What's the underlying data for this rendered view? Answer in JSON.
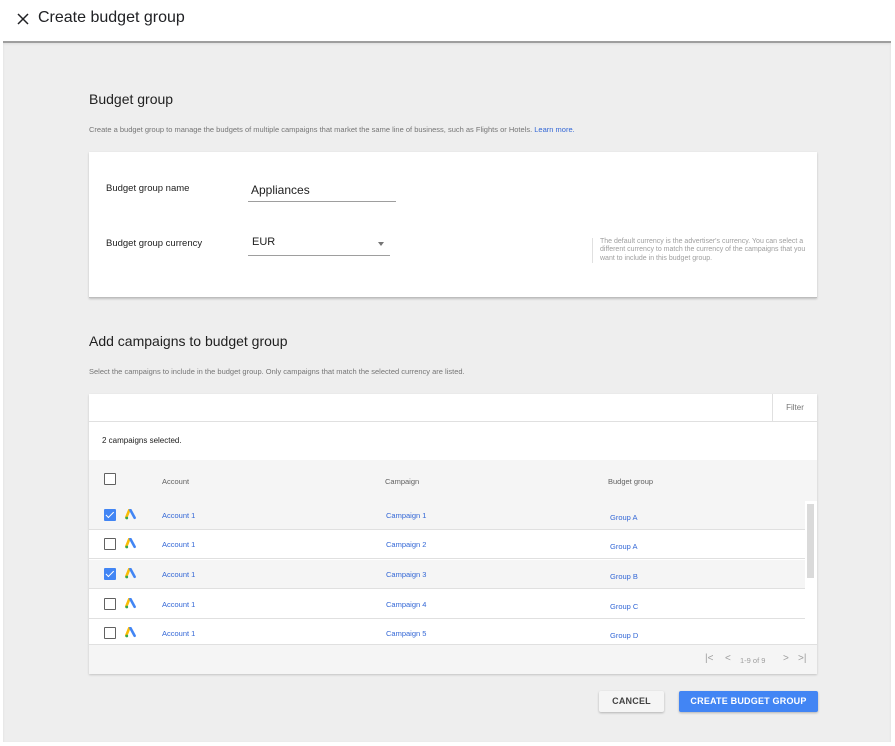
{
  "header": {
    "title": "Create budget group",
    "close_icon": "close-icon"
  },
  "budget_group_section": {
    "title": "Budget group",
    "description": "Create a budget group to manage the budgets of multiple campaigns that market the same line of business, such as Flights or Hotels.",
    "learn_more": "Learn more.",
    "name_label": "Budget group name",
    "name_value": "Appliances",
    "currency_label": "Budget group currency",
    "currency_value": "EUR",
    "currency_helper": "The default currency is the advertiser's currency. You can select a different currency to match the currency of the campaigns that you want to include in this budget group."
  },
  "campaigns_section": {
    "title": "Add campaigns to budget group",
    "description": "Select the campaigns to include in the budget group. Only campaigns that match the selected currency are listed.",
    "filter_label": "Filter",
    "selected_count": "2 campaigns selected.",
    "columns": [
      "Account",
      "Campaign",
      "Budget group"
    ],
    "rows": [
      {
        "checked": true,
        "icon": "google-ads-icon",
        "account": "Account 1",
        "campaign": "Campaign 1",
        "budget_group": "Group A"
      },
      {
        "checked": false,
        "icon": "google-ads-icon",
        "account": "Account 1",
        "campaign": "Campaign 2",
        "budget_group": "Group A"
      },
      {
        "checked": true,
        "icon": "google-ads-icon",
        "account": "Account 1",
        "campaign": "Campaign 3",
        "budget_group": "Group B"
      },
      {
        "checked": false,
        "icon": "google-ads-icon",
        "account": "Account 1",
        "campaign": "Campaign 4",
        "budget_group": "Group C"
      },
      {
        "checked": false,
        "icon": "google-ads-icon",
        "account": "Account 1",
        "campaign": "Campaign 5",
        "budget_group": "Group D"
      }
    ],
    "pagination": {
      "range": "1-9 of 9",
      "first_icon": "|<",
      "prev_icon": "<",
      "next_icon": ">",
      "last_icon": ">|"
    }
  },
  "actions": {
    "cancel_label": "CANCEL",
    "create_label": "CREATE BUDGET GROUP"
  },
  "colors": {
    "primary": "#4285f4",
    "link": "#3367d6",
    "background": "#eeeeee"
  }
}
